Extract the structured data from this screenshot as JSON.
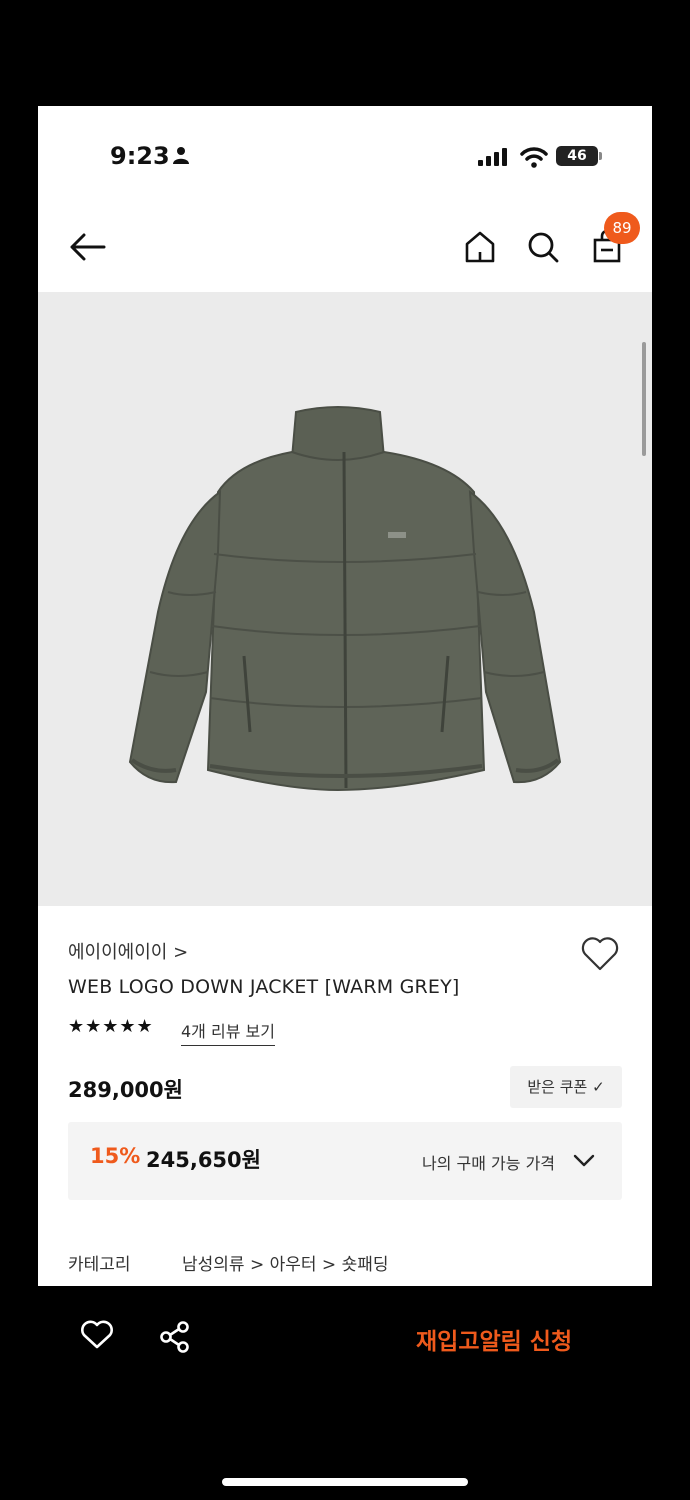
{
  "status_bar": {
    "time": "9:23",
    "battery": "46"
  },
  "header": {
    "cart_count": "89"
  },
  "product": {
    "brand": "에이이에이이 >",
    "title": "WEB LOGO DOWN JACKET [WARM GREY]",
    "rating_stars": "★★★★★",
    "review_link": "4개 리뷰 보기",
    "price": "289,000원",
    "coupon_button": "받은 쿠폰 ✓",
    "discount_rate": "15%",
    "discount_price": "245,650원",
    "my_price_label": "나의 구매 가능 가격",
    "category_label": "카테고리",
    "category_path": "남성의류 > 아우터 > 숏패딩"
  },
  "bottom_bar": {
    "restock_button": "재입고알림 신청"
  },
  "colors": {
    "accent": "#ef5a1c",
    "jacket": "#5e6357",
    "image_bg": "#ebebeb"
  }
}
